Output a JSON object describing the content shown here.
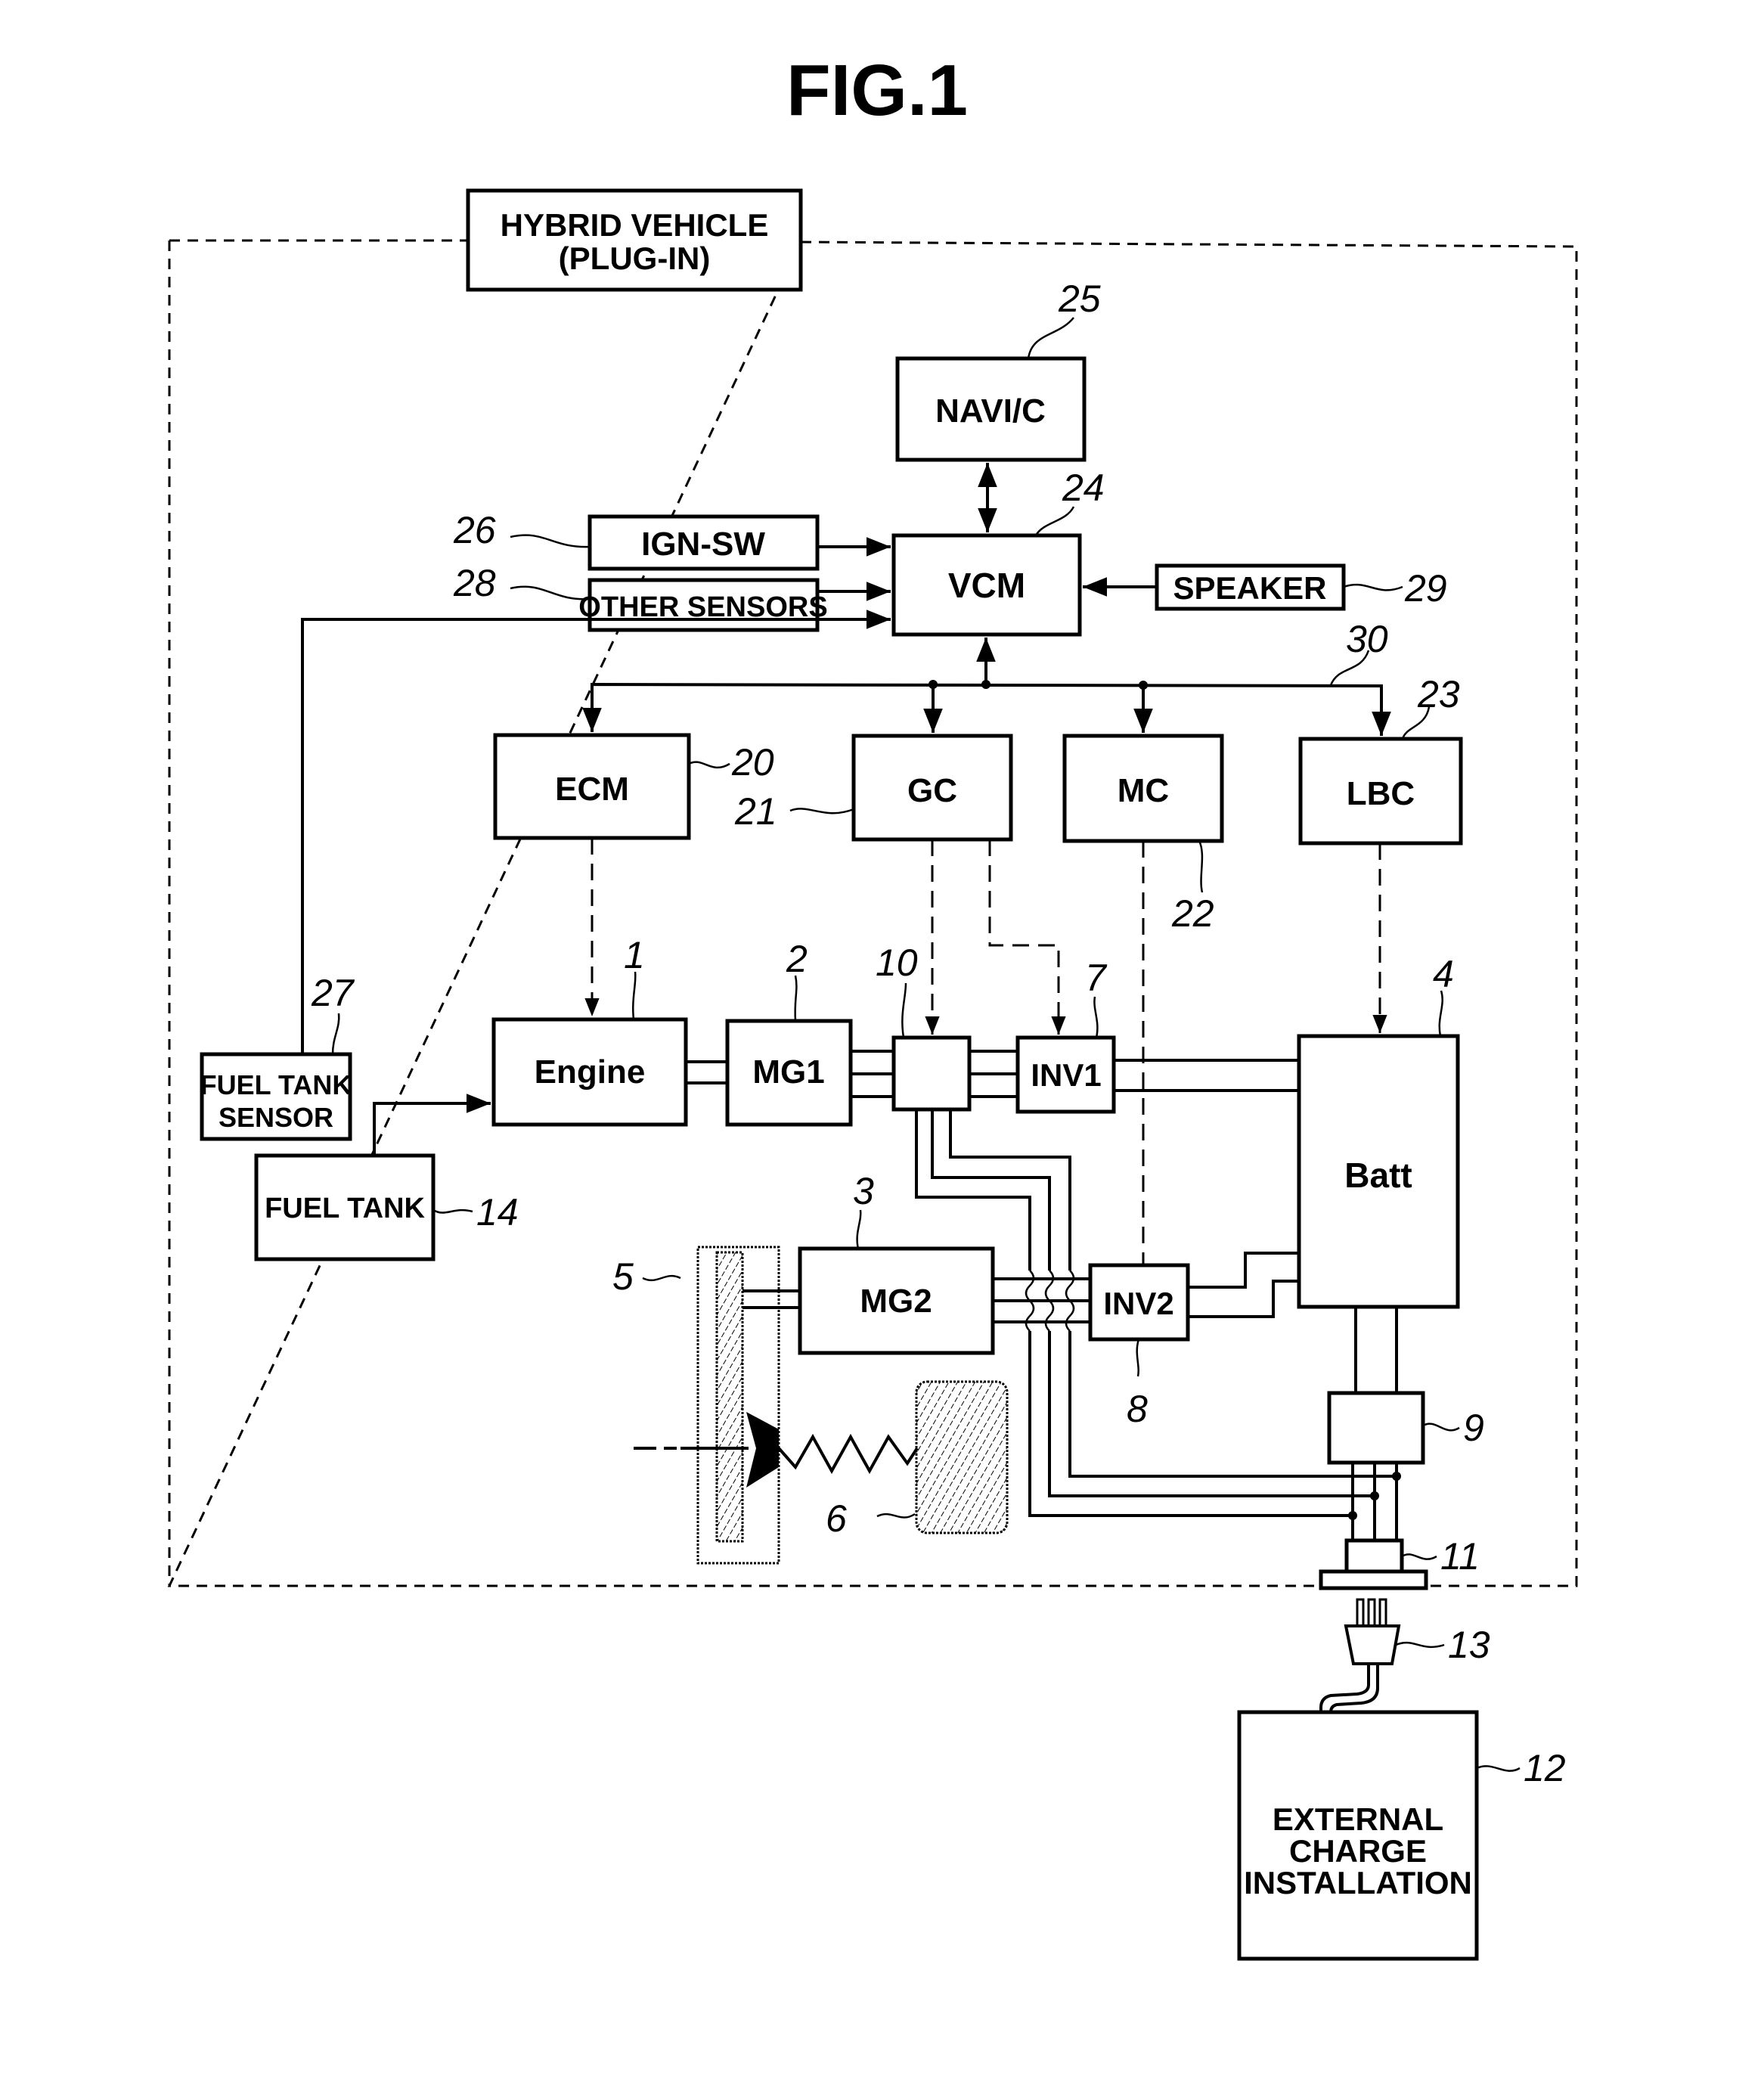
{
  "figure": {
    "title": "FIG.1"
  },
  "vehicle_label": {
    "line1": "HYBRID VEHICLE",
    "line2": "(PLUG-IN)"
  },
  "components": {
    "navi": {
      "label": "NAVI/C",
      "ref": "25"
    },
    "vcm": {
      "label": "VCM",
      "ref": "24"
    },
    "ign_sw": {
      "label": "IGN-SW",
      "ref": "26"
    },
    "other_sensors": {
      "label": "OTHER SENSORS",
      "ref": "28"
    },
    "speaker": {
      "label": "SPEAKER",
      "ref": "29"
    },
    "bus": {
      "ref": "30"
    },
    "ecm": {
      "label": "ECM",
      "ref": "20"
    },
    "gc": {
      "label": "GC",
      "ref": "21"
    },
    "mc": {
      "label": "MC",
      "ref": "22"
    },
    "lbc": {
      "label": "LBC",
      "ref": "23"
    },
    "engine": {
      "label": "Engine",
      "ref": "1"
    },
    "mg1": {
      "label": "MG1",
      "ref": "2"
    },
    "mg2": {
      "label": "MG2",
      "ref": "3"
    },
    "batt": {
      "label": "Batt",
      "ref": "4"
    },
    "gear": {
      "ref": "5"
    },
    "wheel": {
      "ref": "6"
    },
    "inv1": {
      "label": "INV1",
      "ref": "7"
    },
    "inv2": {
      "label": "INV2",
      "ref": "8"
    },
    "charger": {
      "ref": "9"
    },
    "splitter": {
      "ref": "10"
    },
    "connector": {
      "ref": "11"
    },
    "external": {
      "line1": "EXTERNAL",
      "line2": "CHARGE",
      "line3": "INSTALLATION",
      "ref": "12"
    },
    "plug": {
      "ref": "13"
    },
    "fuel_tank": {
      "label": "FUEL TANK",
      "ref": "14"
    },
    "fuel_sensor": {
      "line1": "FUEL TANK",
      "line2": "SENSOR",
      "ref": "27"
    }
  }
}
